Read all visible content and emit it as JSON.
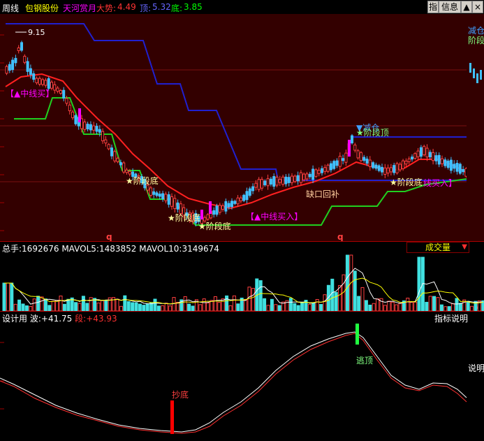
{
  "header": {
    "period": "周线",
    "stock_name": "包钢股份",
    "indicator_name": "天河赏月",
    "trend_label": "大势:",
    "trend_value": "4.49",
    "top_label": "顶:",
    "top_value": "5.32",
    "bottom_label": "底:",
    "bottom_value": "3.85",
    "btn_zhi": "指",
    "btn_info": "信息",
    "btn_up": "▲",
    "btn_close": "×",
    "colors": {
      "period": "#ffffff",
      "stock": "#ffff00",
      "indicator": "#ff00ff",
      "trend": "#ff3333",
      "top": "#6666ff",
      "bottom": "#00ff00"
    }
  },
  "main_chart": {
    "high_marker": "9.15",
    "labels": {
      "mid_buy_1": "【▲中线买】",
      "stage_bottom_1": "★阶段底",
      "stage_bottom_2": "★阶段底",
      "stage_bottom_3": "★阶段底",
      "mid_buy_2": "【▲中线买入】",
      "gap_fill": "缺口回补",
      "reduce": "▼减仓",
      "stage_top": "★阶段顶",
      "stage_bottom_4": "★阶段底",
      "mid_buy_3": "线买入】",
      "q1": "q",
      "q2": "q",
      "right_reduce": "减仓",
      "right_stage": "阶段"
    }
  },
  "volume_panel": {
    "total_label": "总手:",
    "total_value": "1692676",
    "mavol5_label": "MAVOL5:",
    "mavol5_value": "1483852",
    "mavol10_label": "MAVOL10:",
    "mavol10_value": "3149674",
    "dropdown_label": "成交量",
    "dropdown_arrow": "▼",
    "scroll_arrow": "◀"
  },
  "indicator_panel": {
    "name": "设计用",
    "wave_label": "波:",
    "wave_value": "+41.75",
    "seg_label": "段:",
    "seg_value": "+43.93",
    "explain_button": "指标说明",
    "label_escape_top": "逃顶",
    "label_buy_bottom": "抄底",
    "right_explain": "说明"
  },
  "chart_data": {
    "type": "line",
    "price_axis_range": [
      3.4,
      9.6
    ],
    "indicator_axis_range": [
      0,
      100
    ],
    "notes_series": [
      "candles",
      "red trend line",
      "blue top line",
      "green bottom line"
    ],
    "legend_colors": {
      "trend": "#ff2020",
      "top": "#2020d0",
      "bottom": "#20d020"
    }
  }
}
